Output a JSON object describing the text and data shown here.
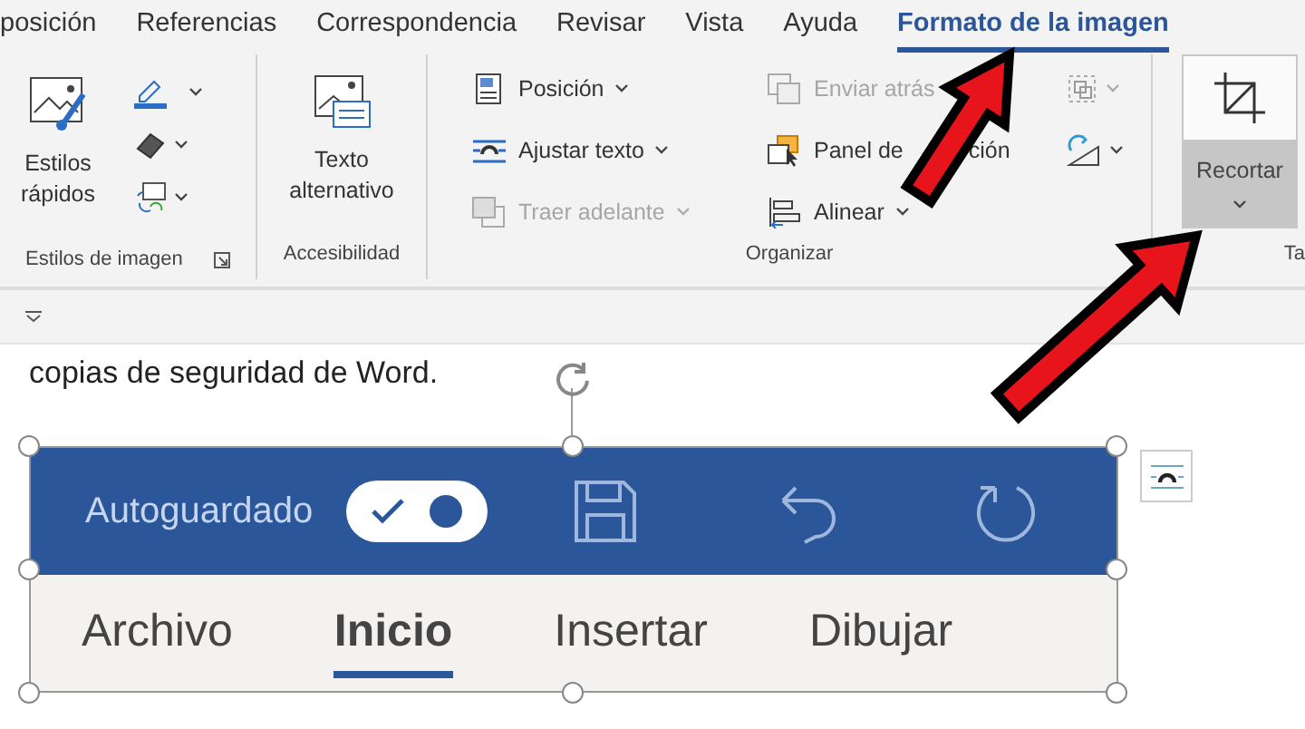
{
  "tabs": [
    {
      "label": "posición",
      "selected": false
    },
    {
      "label": "Referencias",
      "selected": false
    },
    {
      "label": "Correspondencia",
      "selected": false
    },
    {
      "label": "Revisar",
      "selected": false
    },
    {
      "label": "Vista",
      "selected": false
    },
    {
      "label": "Ayuda",
      "selected": false
    },
    {
      "label": "Formato de la imagen",
      "selected": true
    }
  ],
  "picture_styles_group": {
    "label": "Estilos de imagen",
    "quick_styles": "Estilos rápidos"
  },
  "accessibility_group": {
    "label": "Accesibilidad",
    "alt_text": "Texto alternativo"
  },
  "arrange_group": {
    "label": "Organizar",
    "commands": [
      {
        "label": "Posición",
        "disabled": false
      },
      {
        "label": "Ajustar texto",
        "disabled": false
      },
      {
        "label": "Traer adelante",
        "disabled": true
      },
      {
        "label": "Enviar atrás",
        "disabled": true
      },
      {
        "label": "Panel de",
        "label_tail": "ción",
        "disabled": false
      },
      {
        "label": "Alinear",
        "disabled": false
      }
    ]
  },
  "crop_button": {
    "label": "Recortar"
  },
  "size_group": {
    "label": "Ta"
  },
  "document": {
    "text": "copias de seguridad de Word."
  },
  "embedded_image": {
    "autosave_label": "Autoguardado",
    "autosave_on": true,
    "tabs": [
      {
        "label": "Archivo",
        "selected": false
      },
      {
        "label": "Inicio",
        "selected": true
      },
      {
        "label": "Insertar",
        "selected": false
      },
      {
        "label": "Dibujar",
        "selected": false
      }
    ]
  }
}
